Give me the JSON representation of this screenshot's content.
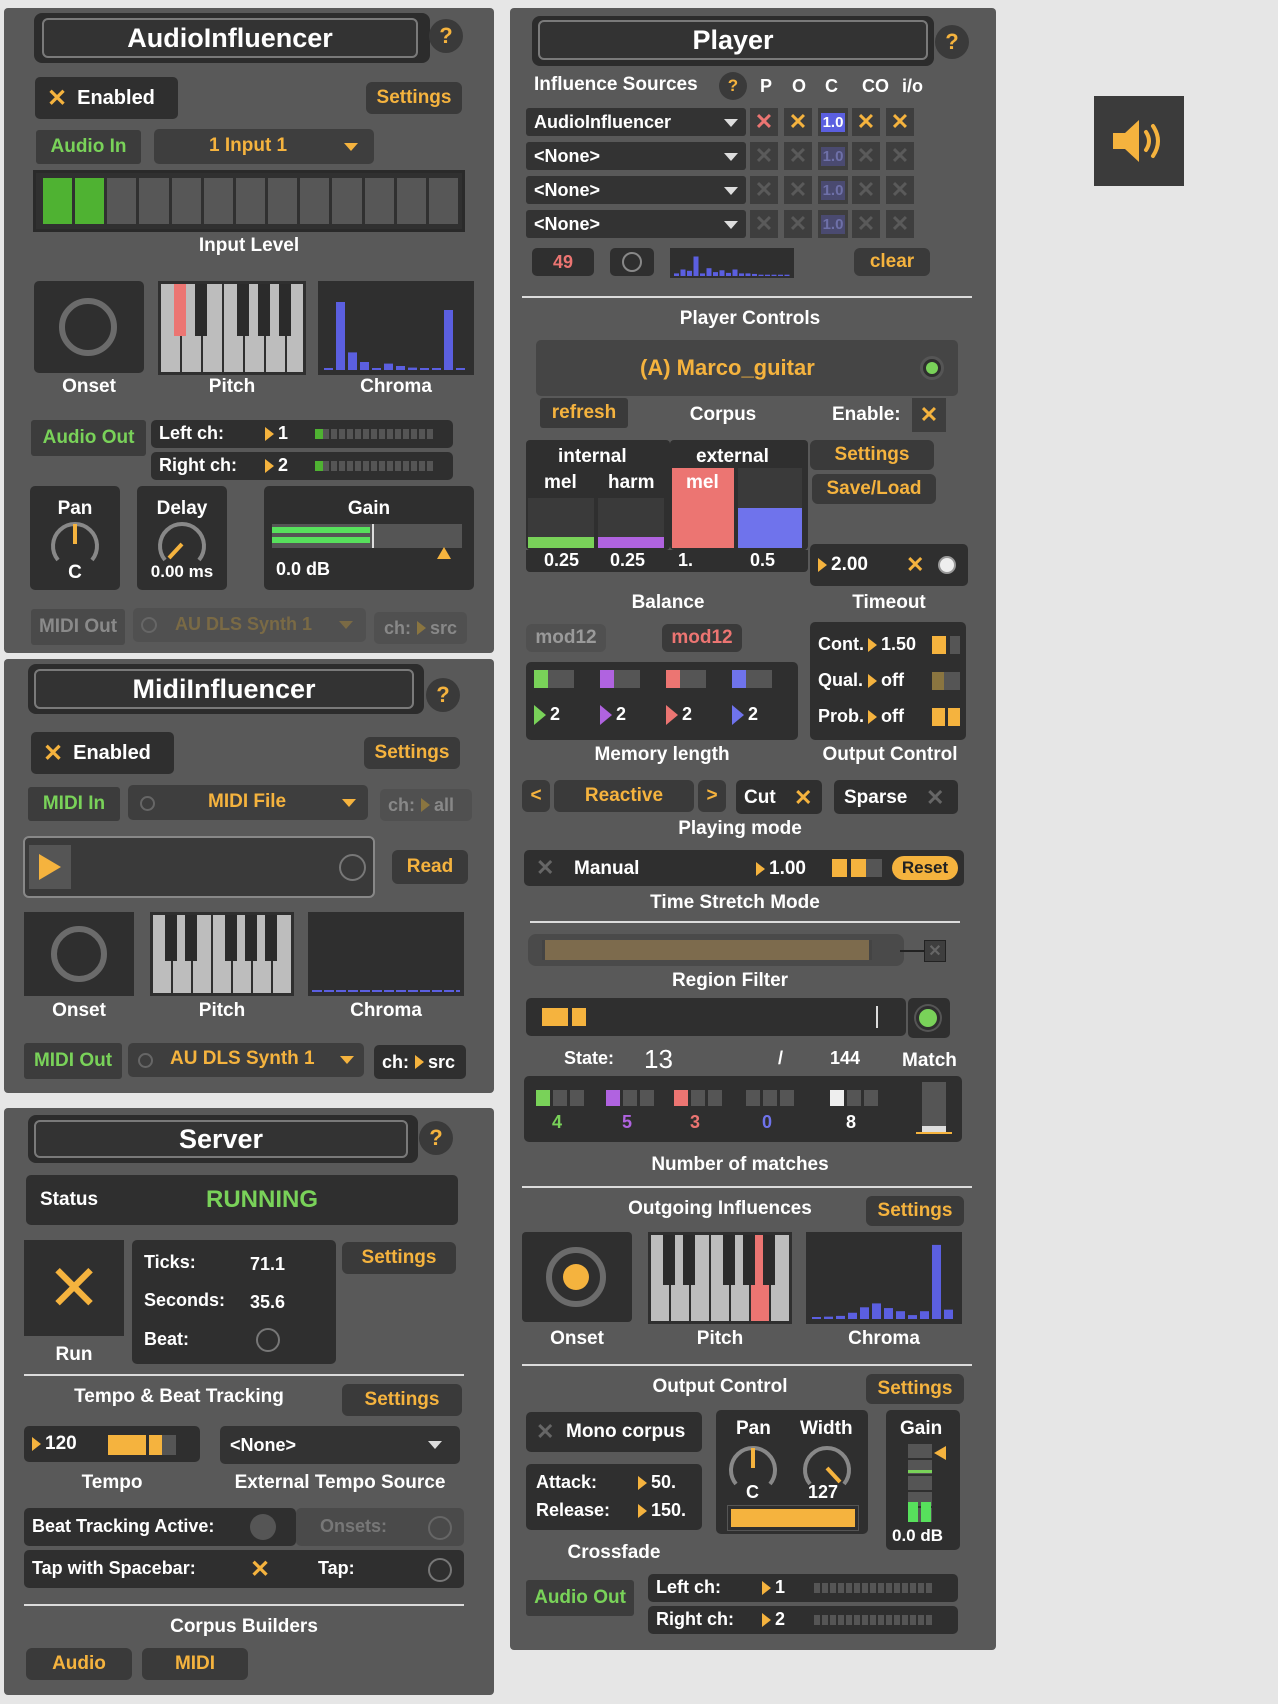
{
  "audio": {
    "title": "AudioInfluencer",
    "help": "?",
    "enabled": "Enabled",
    "settings": "Settings",
    "audio_in": "Audio In",
    "input_select": "1 Input 1",
    "input_level": "Input Level",
    "onset": "Onset",
    "pitch": "Pitch",
    "chroma": "Chroma",
    "audio_out": "Audio Out",
    "left_ch": "Left ch:",
    "left_val": "1",
    "right_ch": "Right ch:",
    "right_val": "2",
    "pan": "Pan",
    "pan_val": "C",
    "delay": "Delay",
    "delay_val": "0.00 ms",
    "gain": "Gain",
    "gain_val": "0.0 dB",
    "midi_out": "MIDI Out",
    "synth": "AU DLS Synth 1",
    "ch": "ch:",
    "ch_val": "src",
    "input_level_fraction": 0.15
  },
  "midi": {
    "title": "MidiInfluencer",
    "help": "?",
    "enabled": "Enabled",
    "settings": "Settings",
    "midi_in": "MIDI In",
    "midi_file": "MIDI File",
    "ch": "ch:",
    "ch_all": "all",
    "read": "Read",
    "onset": "Onset",
    "pitch": "Pitch",
    "chroma": "Chroma",
    "midi_out": "MIDI Out",
    "synth": "AU DLS Synth 1",
    "ch_src": "src"
  },
  "server": {
    "title": "Server",
    "help": "?",
    "status_label": "Status",
    "status_val": "RUNNING",
    "run": "Run",
    "ticks_label": "Ticks:",
    "ticks_val": "71.1",
    "seconds_label": "Seconds:",
    "seconds_val": "35.6",
    "beat_label": "Beat:",
    "settings": "Settings",
    "tempo_title": "Tempo & Beat Tracking",
    "tempo_settings": "Settings",
    "tempo_val": "120",
    "tempo_label": "Tempo",
    "ext_source": "<None>",
    "ext_label": "External Tempo Source",
    "beat_tracking": "Beat Tracking Active:",
    "onsets": "Onsets:",
    "tap_space": "Tap with Spacebar:",
    "tap": "Tap:",
    "corpus_builders": "Corpus Builders",
    "audio_btn": "Audio",
    "midi_btn": "MIDI"
  },
  "player": {
    "title": "Player",
    "help": "?",
    "influence_sources": "Influence Sources",
    "col_p": "P",
    "col_o": "O",
    "col_c": "C",
    "col_co": "CO",
    "col_io": "i/o",
    "sources": [
      "AudioInfluencer",
      "<None>",
      "<None>",
      "<None>"
    ],
    "c_val": "1.0",
    "count": "49",
    "clear": "clear",
    "player_controls": "Player Controls",
    "corpus_name": "(A) Marco_guitar",
    "refresh": "refresh",
    "corpus": "Corpus",
    "enable": "Enable:",
    "internal": "internal",
    "external": "external",
    "mel": "mel",
    "harm": "harm",
    "bal_vals": [
      "0.25",
      "0.25",
      "1.",
      "0.5"
    ],
    "balance": "Balance",
    "settings": "Settings",
    "saveload": "Save/Load",
    "timeout_val": "2.00",
    "timeout": "Timeout",
    "mod12": "mod12",
    "cont": "Cont.",
    "cont_val": "1.50",
    "qual": "Qual.",
    "qual_val": "off",
    "prob": "Prob.",
    "prob_val": "off",
    "mem_vals": [
      "2",
      "2",
      "2",
      "2"
    ],
    "memory_length": "Memory length",
    "output_control": "Output Control",
    "lt": "<",
    "reactive": "Reactive",
    "gt": ">",
    "cut": "Cut",
    "sparse": "Sparse",
    "playing_mode": "Playing mode",
    "manual": "Manual",
    "manual_val": "1.00",
    "reset": "Reset",
    "time_stretch": "Time Stretch Mode",
    "region_filter": "Region Filter",
    "state": "State:",
    "state_val": "13",
    "slash": "/",
    "state_total": "144",
    "match": "Match",
    "matches": [
      "4",
      "5",
      "3",
      "0",
      "8"
    ],
    "num_matches": "Number of matches",
    "outgoing": "Outgoing Influences",
    "out_settings": "Settings",
    "onset": "Onset",
    "pitch": "Pitch",
    "chroma": "Chroma",
    "output_control2": "Output Control",
    "oc_settings": "Settings",
    "mono_corpus": "Mono corpus",
    "pan": "Pan",
    "pan_val": "C",
    "width": "Width",
    "width_val": "127",
    "gain": "Gain",
    "gain_val": "0.0 dB",
    "attack": "Attack:",
    "attack_val": "50.",
    "release": "Release:",
    "release_val": "150.",
    "crossfade": "Crossfade",
    "audio_out": "Audio Out",
    "left_ch": "Left ch:",
    "left_val": "1",
    "right_ch": "Right ch:",
    "right_val": "2"
  },
  "colors": {
    "orange": "#f5b33e",
    "green": "#79d259",
    "panel": "#595959",
    "mel": "#79d259",
    "harm": "#b063e0",
    "ext_mel": "#ec7572",
    "ext_harm": "#6f73ec",
    "chroma_blue": "#5b5fe0"
  },
  "icons": {
    "speaker": "speaker-icon"
  }
}
